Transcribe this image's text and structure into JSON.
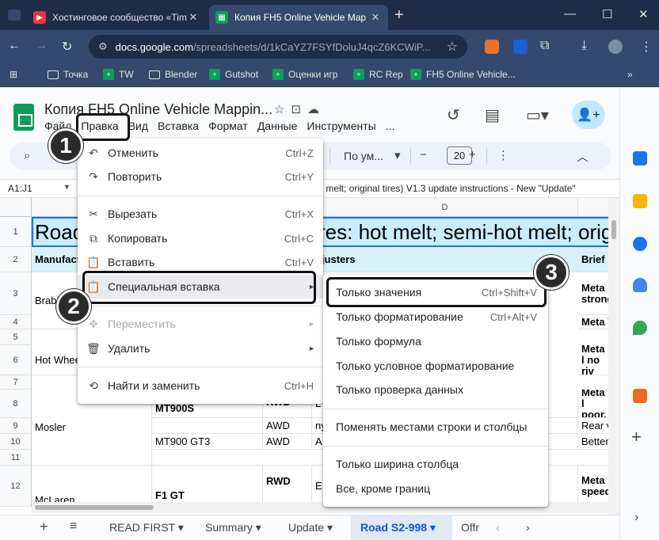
{
  "browser": {
    "tabs": [
      {
        "title": "Хостинговое сообщество «Tim",
        "favicon": "red-play-icon"
      },
      {
        "title": "Копия FH5 Online Vehicle Map",
        "favicon": "sheets-icon"
      }
    ],
    "url_host": "docs.google.com",
    "url_path": "/spreadsheets/d/1kCaYZ7FSYfDoluJ4qcZ6KCWiP...",
    "bookmarks": [
      "Точка",
      "TW",
      "Blender",
      "Gutshot",
      "Оценки игр",
      "RC Rep",
      "FH5 Online Vehicle..."
    ]
  },
  "sheets": {
    "title": "Копия FH5 Online Vehicle Mappin...",
    "menus": [
      "Файл",
      "Правка",
      "Вид",
      "Вставка",
      "Формат",
      "Данные",
      "Инструменты",
      "..."
    ],
    "toolbar": {
      "font": "По ум...",
      "font_size": "20",
      "minus": "−",
      "plus": "+"
    },
    "namebox": "A1:J1",
    "formula_text": "ot melt; original tires) V1.3 update instructions - New \"Update\"",
    "col_d": "D",
    "rows": [
      "1",
      "2",
      "3",
      "4",
      "5",
      "6",
      "7",
      "8",
      "9",
      "10",
      "11",
      "12"
    ],
    "cells": {
      "a1": "Road",
      "d1": "res: hot melt; semi-hot melt; orig",
      "a2": "Manufact",
      "d2": "djusters",
      "e2": "Brief I",
      "a3": "Brabha",
      "e3": "Meta l strong",
      "e4": "Meta V",
      "a6": "Hot Whee",
      "e6": "Meta l no riv",
      "a8": "Mosler",
      "b8": "MT900S",
      "c8": "RWD",
      "d8": "L",
      "e8": "Meta l poor.",
      "c9": "AWD",
      "d9": "ny",
      "e9": "Rear v",
      "b10": "MT900 GT3",
      "c10": "AWD",
      "d10": "A",
      "e10": "Better",
      "a12": "McLaren",
      "b12": "F1 GT",
      "c12": "RWD",
      "d12": "E",
      "e12": "Meta l speed"
    },
    "sheet_tabs": [
      "READ FIRST",
      "Summary",
      "Update",
      "Road S2-998",
      "Offr"
    ],
    "active_sheet": "Road S2-998"
  },
  "edit_menu": {
    "items": [
      {
        "label": "Отменить",
        "shortcut": "Ctrl+Z",
        "icon": "undo-icon"
      },
      {
        "label": "Повторить",
        "shortcut": "Ctrl+Y",
        "icon": "redo-icon"
      },
      {
        "label": "Вырезать",
        "shortcut": "Ctrl+X",
        "icon": "scissors-icon"
      },
      {
        "label": "Копировать",
        "shortcut": "Ctrl+C",
        "icon": "copy-icon"
      },
      {
        "label": "Вставить",
        "shortcut": "Ctrl+V",
        "icon": "paste-icon"
      },
      {
        "label": "Специальная вставка",
        "shortcut": "",
        "icon": "paste-special-icon"
      },
      {
        "label": "Переместить",
        "shortcut": "",
        "icon": "move-icon"
      },
      {
        "label": "Удалить",
        "shortcut": "",
        "icon": "trash-icon"
      },
      {
        "label": "Найти и заменить",
        "shortcut": "Ctrl+H",
        "icon": "find-replace-icon"
      }
    ]
  },
  "paste_special_menu": {
    "items": [
      {
        "label": "Только значения",
        "shortcut": "Ctrl+Shift+V"
      },
      {
        "label": "Только форматирование",
        "shortcut": "Ctrl+Alt+V"
      },
      {
        "label": "Только формула",
        "shortcut": ""
      },
      {
        "label": "Только условное форматирование",
        "shortcut": ""
      },
      {
        "label": "Только проверка данных",
        "shortcut": ""
      },
      {
        "label": "Поменять местами строки и столбцы",
        "shortcut": ""
      },
      {
        "label": "Только ширина столбца",
        "shortcut": ""
      },
      {
        "label": "Все, кроме границ",
        "shortcut": ""
      }
    ]
  },
  "annotations": {
    "badges": [
      "1",
      "2",
      "3"
    ]
  },
  "colors": {
    "accent": "#0b57d0",
    "row1_fill": "#c9ecfb",
    "sheets_green": "#0f9d58"
  }
}
